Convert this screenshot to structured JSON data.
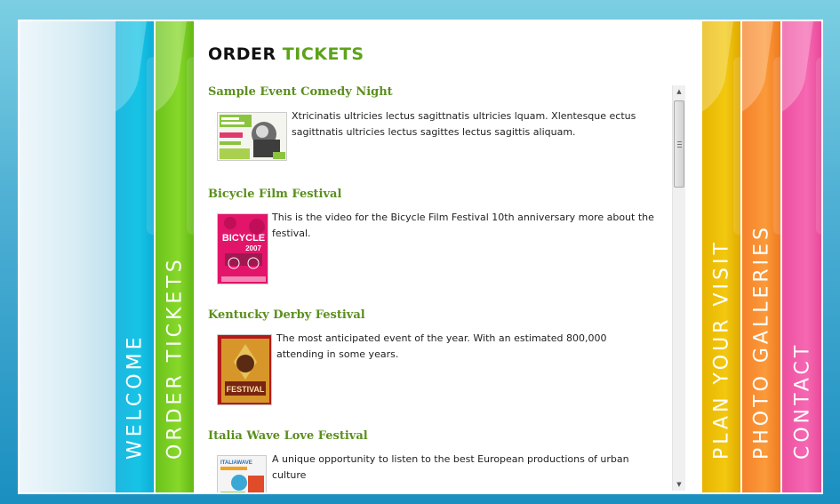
{
  "nav": {
    "welcome": "WELCOME",
    "order_tickets": "ORDER TICKETS",
    "plan_your_visit": "PLAN YOUR VISIT",
    "photo_galleries": "PHOTO GALLERIES",
    "contact": "CONTACT"
  },
  "page": {
    "title_word1": "ORDER",
    "title_word2": "TICKETS"
  },
  "events": [
    {
      "title": "Sample Event Comedy Night",
      "description": "Xtricinatis ultricies lectus sagittnatis ultricies lquam. Xlentesque ectus sagittnatis ultricies lectus sagittes lectus sagittis aliquam.",
      "thumb_icon": "comedy-poster-image"
    },
    {
      "title": "Bicycle Film Festival",
      "description": "This is the video for the Bicycle Film Festival 10th anniversary more about the festival.",
      "thumb_text": "BICYCLE",
      "thumb_year": "2007",
      "thumb_icon": "bicycle-poster-image"
    },
    {
      "title": "Kentucky Derby Festival",
      "description": "The most anticipated event of the year. With an estimated 800,000 attending in some years.",
      "thumb_text": "FESTIVAL",
      "thumb_icon": "derby-poster-image"
    },
    {
      "title": "Italia Wave Love Festival",
      "description": "A unique opportunity to listen to the best European productions of urban culture",
      "thumb_text": "ITALIAWAVE",
      "thumb_icon": "italia-wave-poster-image"
    }
  ],
  "colors": {
    "welcome": "#16c4e6",
    "order_tickets": "#86d829",
    "plan_your_visit": "#f2c90f",
    "photo_galleries": "#fb9a3a",
    "contact": "#f668b3",
    "title_accent": "#5ea21b",
    "event_title": "#5b8f1d"
  }
}
